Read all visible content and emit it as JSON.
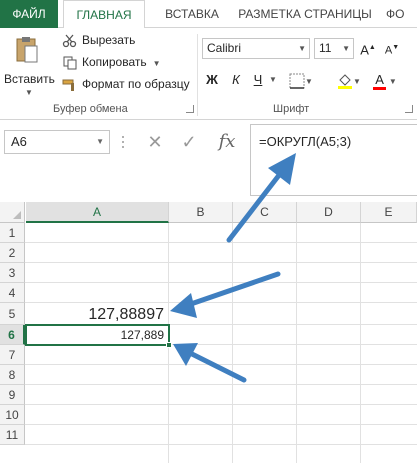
{
  "ribbon": {
    "tabs": [
      {
        "label": "ФАЙЛ"
      },
      {
        "label": "ГЛАВНАЯ"
      },
      {
        "label": "ВСТАВКА"
      },
      {
        "label": "РАЗМЕТКА СТРАНИЦЫ"
      },
      {
        "label": "ФО"
      }
    ],
    "clipboard": {
      "paste_label": "Вставить",
      "cut_label": "Вырезать",
      "copy_label": "Копировать",
      "format_painter_label": "Формат по образцу",
      "group_label": "Буфер обмена"
    },
    "font": {
      "font_name": "Calibri",
      "font_size": "11",
      "bold_label": "Ж",
      "italic_label": "К",
      "underline_label": "Ч",
      "font_color_label": "A",
      "group_label": "Шрифт"
    }
  },
  "formula_bar": {
    "name_box": "A6",
    "fx_label": "fx",
    "formula": "=ОКРУГЛ(A5;3)"
  },
  "grid": {
    "columns": [
      "A",
      "B",
      "C",
      "D",
      "E"
    ],
    "rows": [
      "1",
      "2",
      "3",
      "4",
      "5",
      "6",
      "7",
      "8",
      "9",
      "10",
      "11"
    ],
    "cells": {
      "a5": "127,88897",
      "a6": "127,889"
    }
  },
  "colors": {
    "accent": "#217346",
    "arrow": "#3f7fc0",
    "highlight": "#ffff00",
    "font_color": "#ff0000"
  }
}
